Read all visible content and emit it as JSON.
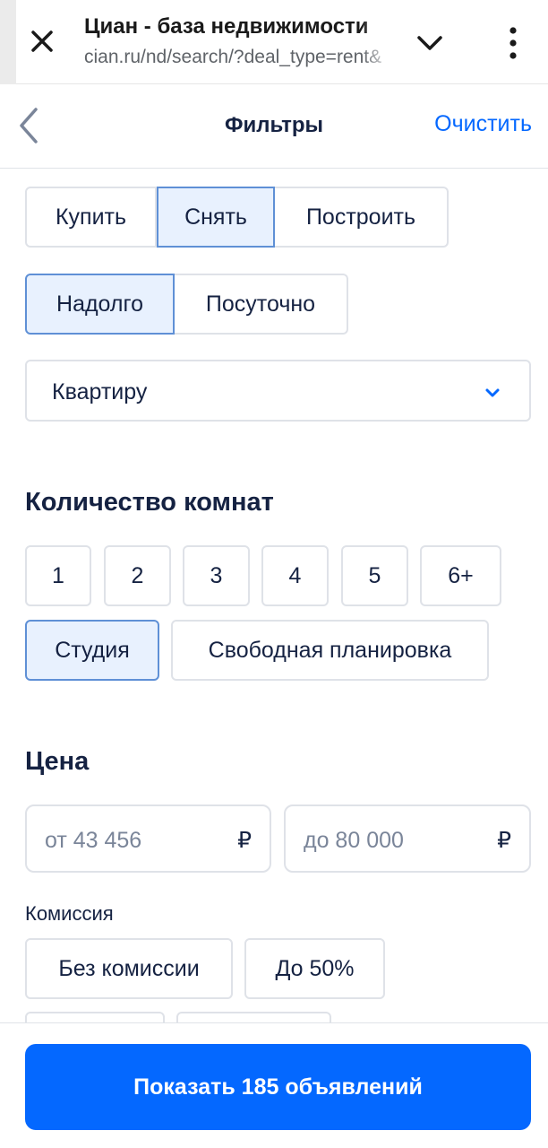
{
  "browser": {
    "title": "Циан - база недвижимости",
    "url": "cian.ru/nd/search/?deal_type=rent&"
  },
  "header": {
    "title": "Фильтры",
    "clear_label": "Очистить"
  },
  "deal_type": {
    "options": [
      "Купить",
      "Снять",
      "Построить"
    ],
    "selected": "Снять"
  },
  "rent_term": {
    "options": [
      "Надолго",
      "Посуточно"
    ],
    "selected": "Надолго"
  },
  "object_type": {
    "value": "Квартиру"
  },
  "rooms": {
    "title": "Количество комнат",
    "options": [
      "1",
      "2",
      "3",
      "4",
      "5",
      "6+"
    ],
    "studio_label": "Студия",
    "free_layout_label": "Свободная планировка",
    "studio_selected": true
  },
  "price": {
    "title": "Цена",
    "from_placeholder": "от 43 456",
    "to_placeholder": "до 80 000",
    "currency": "₽"
  },
  "commission": {
    "label": "Комиссия",
    "options": [
      "Без комиссии",
      "До 50%"
    ]
  },
  "cta": {
    "label": "Показать 185 объявлений"
  },
  "colors": {
    "accent": "#0468ff",
    "selected_bg": "#e8f1fe",
    "selected_border": "#5f90d6",
    "text": "#152242"
  }
}
